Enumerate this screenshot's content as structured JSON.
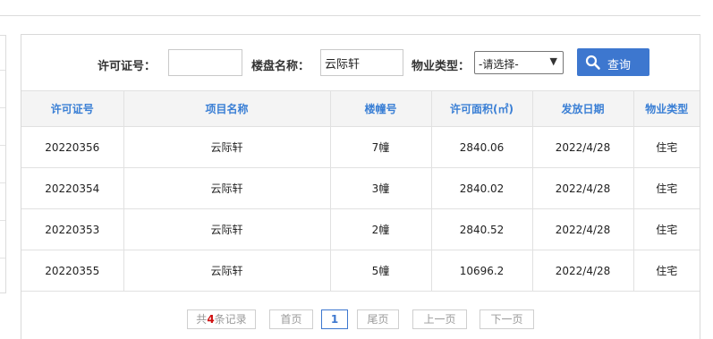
{
  "search": {
    "permit_label": "许可证号：",
    "permit_value": "",
    "estate_label": "楼盘名称：",
    "estate_value": "云际轩",
    "type_label": "物业类型：",
    "type_selected": "-请选择-",
    "query_label": "查询",
    "query_icon": "search-icon"
  },
  "table": {
    "headers": [
      "许可证号",
      "项目名称",
      "楼幢号",
      "许可面积(㎡)",
      "发放日期",
      "物业类型"
    ],
    "rows": [
      [
        "20220356",
        "云际轩",
        "7幢",
        "2840.06",
        "2022/4/28",
        "住宅"
      ],
      [
        "20220354",
        "云际轩",
        "3幢",
        "2840.02",
        "2022/4/28",
        "住宅"
      ],
      [
        "20220353",
        "云际轩",
        "2幢",
        "2840.52",
        "2022/4/28",
        "住宅"
      ],
      [
        "20220355",
        "云际轩",
        "5幢",
        "10696.2",
        "2022/4/28",
        "住宅"
      ]
    ]
  },
  "pager": {
    "total_prefix": "共",
    "total_count": "4",
    "total_suffix": "条记录",
    "first": "首页",
    "current": "1",
    "last": "尾页",
    "prev": "上一页",
    "next": "下一页"
  },
  "colors": {
    "accent": "#3d77cf",
    "header_text": "#3a7fd5",
    "count_red": "#d01010"
  }
}
